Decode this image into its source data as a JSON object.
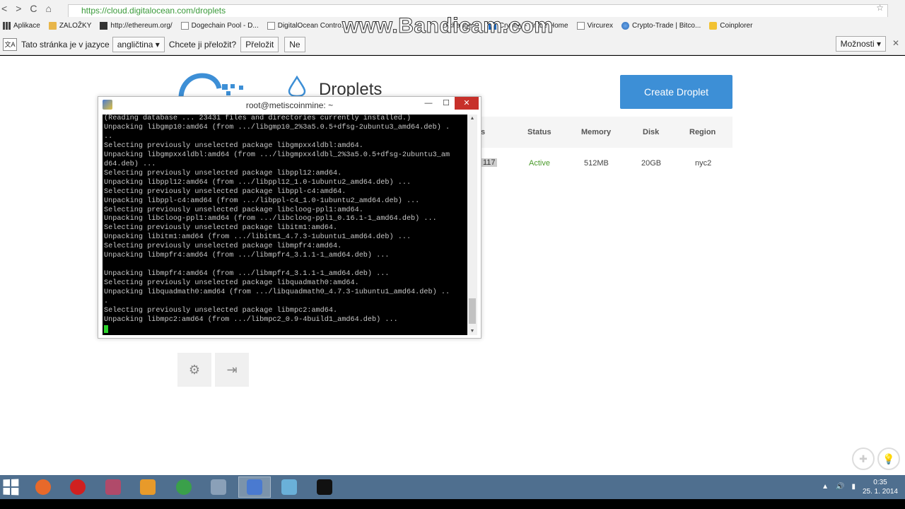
{
  "browser": {
    "url": "https://cloud.digitalocean.com/droplets",
    "bookmarks": [
      {
        "label": "Aplikace",
        "icon": "apps-icon"
      },
      {
        "label": "ZALOŽKY",
        "icon": "folder-icon"
      },
      {
        "label": "http://ethereum.org/",
        "icon": "ethereum-icon"
      },
      {
        "label": "Dogechain Pool - D...",
        "icon": "page-icon"
      },
      {
        "label": "DigitalOcean Contro...",
        "icon": "page-icon"
      },
      {
        "label": "Exchange ...",
        "icon": "page-icon"
      },
      {
        "label": "Cryptsy - Trade Home",
        "icon": "cryptsy-icon"
      },
      {
        "label": "Vircurex",
        "icon": "page-icon"
      },
      {
        "label": "Crypto-Trade | Bitco...",
        "icon": "globe-icon"
      },
      {
        "label": "Coinplorer",
        "icon": "coin-icon"
      }
    ],
    "translate_bar": {
      "prefix": "Tato stránka je v jazyce",
      "language": "angličtina",
      "question": "Chcete ji přeložit?",
      "translate_button": "Přeložit",
      "no_button": "Ne",
      "options": "Možnosti"
    }
  },
  "watermark": "www.Bandicam.com",
  "page": {
    "title": "Droplets",
    "create_button": "Create Droplet",
    "table": {
      "headers": [
        "s",
        "Status",
        "Memory",
        "Disk",
        "Region"
      ],
      "row": {
        "ip_fragment": "117",
        "status": "Active",
        "memory": "512MB",
        "disk": "20GB",
        "region": "nyc2"
      }
    }
  },
  "terminal": {
    "title": "root@metiscoinmine: ~",
    "lines": [
      "(Reading database ... 23431 files and directories currently installed.)",
      "Unpacking libgmp10:amd64 (from .../libgmp10_2%3a5.0.5+dfsg-2ubuntu3_amd64.deb) .",
      "..",
      "Selecting previously unselected package libgmpxx4ldbl:amd64.",
      "Unpacking libgmpxx4ldbl:amd64 (from .../libgmpxx4ldbl_2%3a5.0.5+dfsg-2ubuntu3_am",
      "d64.deb) ...",
      "Selecting previously unselected package libppl12:amd64.",
      "Unpacking libppl12:amd64 (from .../libppl12_1.0-1ubuntu2_amd64.deb) ...",
      "Selecting previously unselected package libppl-c4:amd64.",
      "Unpacking libppl-c4:amd64 (from .../libppl-c4_1.0-1ubuntu2_amd64.deb) ...",
      "Selecting previously unselected package libcloog-ppl1:amd64.",
      "Unpacking libcloog-ppl1:amd64 (from .../libcloog-ppl1_0.16.1-1_amd64.deb) ...",
      "Selecting previously unselected package libitm1:amd64.",
      "Unpacking libitm1:amd64 (from .../libitm1_4.7.3-1ubuntu1_amd64.deb) ...",
      "Selecting previously unselected package libmpfr4:amd64.",
      "Unpacking libmpfr4:amd64 (from .../libmpfr4_3.1.1-1_amd64.deb) ...",
      "",
      "Unpacking libmpfr4:amd64 (from .../libmpfr4_3.1.1-1_amd64.deb) ...",
      "Selecting previously unselected package libquadmath0:amd64.",
      "Unpacking libquadmath0:amd64 (from .../libquadmath0_4.7.3-1ubuntu1_amd64.deb) ..",
      ".",
      "Selecting previously unselected package libmpc2:amd64.",
      "Unpacking libmpc2:amd64 (from .../libmpc2_0.9-4build1_amd64.deb) ..."
    ]
  },
  "taskbar": {
    "apps": [
      {
        "name": "firefox",
        "color": "#e8692a"
      },
      {
        "name": "opera",
        "color": "#d02020"
      },
      {
        "name": "app",
        "color": "#b04a6a"
      },
      {
        "name": "media-player",
        "color": "#e89a2a"
      },
      {
        "name": "chrome",
        "color": "#3aa04a"
      },
      {
        "name": "calculator",
        "color": "#8aa0b8"
      },
      {
        "name": "putty",
        "color": "#4a7ad0"
      },
      {
        "name": "app-blue",
        "color": "#6ab0d8"
      },
      {
        "name": "cmd",
        "color": "#111111"
      }
    ],
    "time": "0:35",
    "date": "25. 1. 2014"
  },
  "colors": {
    "accent": "#3d8fd6",
    "active_status": "#4a9a2a",
    "close_red": "#c7302a"
  }
}
